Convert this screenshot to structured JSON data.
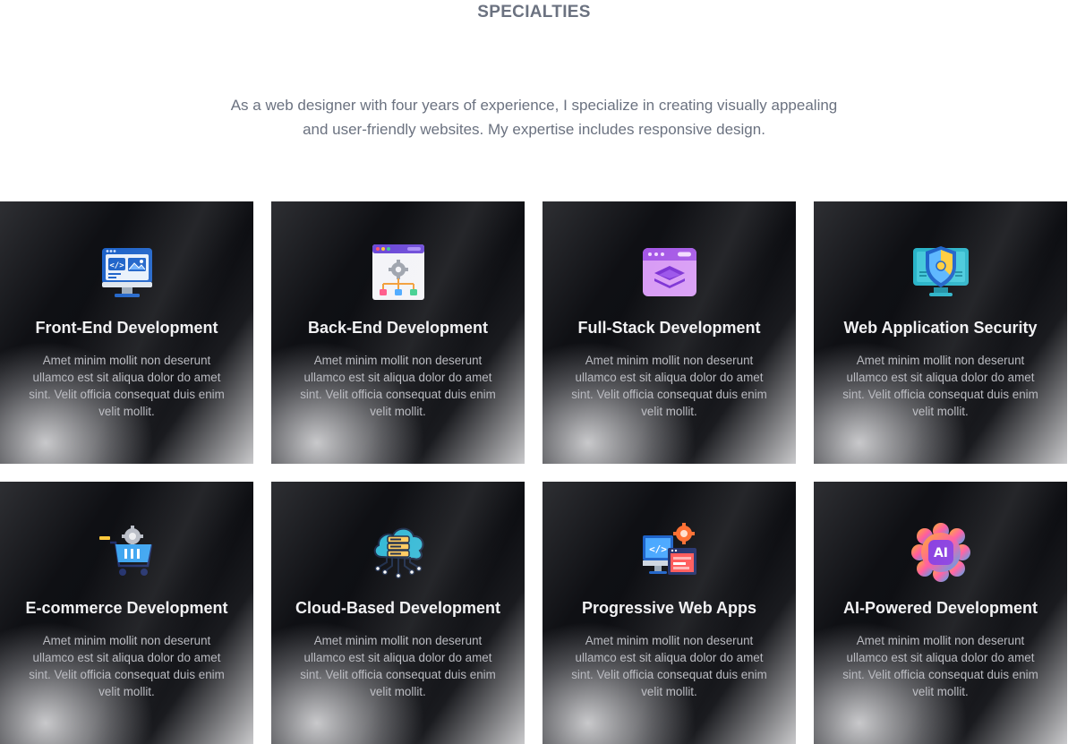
{
  "section": {
    "title": "SPECIALTIES",
    "intro_line1": "As a web designer with four years of experience, I specialize in creating visually appealing",
    "intro_line2": "and user-friendly websites. My expertise includes responsive design."
  },
  "cards": [
    {
      "icon": "code-monitor-icon",
      "title": "Front-End Development",
      "description": "Amet minim mollit non deserunt ullamco est sit aliqua dolor do amet sint. Velit officia consequat duis enim velit mollit."
    },
    {
      "icon": "server-gear-icon",
      "title": "Back-End Development",
      "description": "Amet minim mollit non deserunt ullamco est sit aliqua dolor do amet sint. Velit officia consequat duis enim velit mollit."
    },
    {
      "icon": "layers-window-icon",
      "title": "Full-Stack Development",
      "description": "Amet minim mollit non deserunt ullamco est sit aliqua dolor do amet sint. Velit officia consequat duis enim velit mollit."
    },
    {
      "icon": "shield-monitor-icon",
      "title": "Web Application Security",
      "description": "Amet minim mollit non deserunt ullamco est sit aliqua dolor do amet sint. Velit officia consequat duis enim velit mollit."
    },
    {
      "icon": "shopping-cart-gear-icon",
      "title": "E-commerce Development",
      "description": "Amet minim mollit non deserunt ullamco est sit aliqua dolor do amet sint. Velit officia consequat duis enim velit mollit."
    },
    {
      "icon": "cloud-server-icon",
      "title": "Cloud-Based Development",
      "description": "Amet minim mollit non deserunt ullamco est sit aliqua dolor do amet sint. Velit officia consequat duis enim velit mollit."
    },
    {
      "icon": "devices-gear-icon",
      "title": "Progressive Web Apps",
      "description": "Amet minim mollit non deserunt ullamco est sit aliqua dolor do amet sint. Velit officia consequat duis enim velit mollit."
    },
    {
      "icon": "ai-badge-icon",
      "title": "AI-Powered Development",
      "description": "Amet minim mollit non deserunt ullamco est sit aliqua dolor do amet sint. Velit officia consequat duis enim velit mollit."
    }
  ],
  "colors": {
    "title_text": "#6b7280",
    "card_title": "#f1f1f3",
    "card_desc": "#b9bac0",
    "card_bg": "#0f1014"
  }
}
